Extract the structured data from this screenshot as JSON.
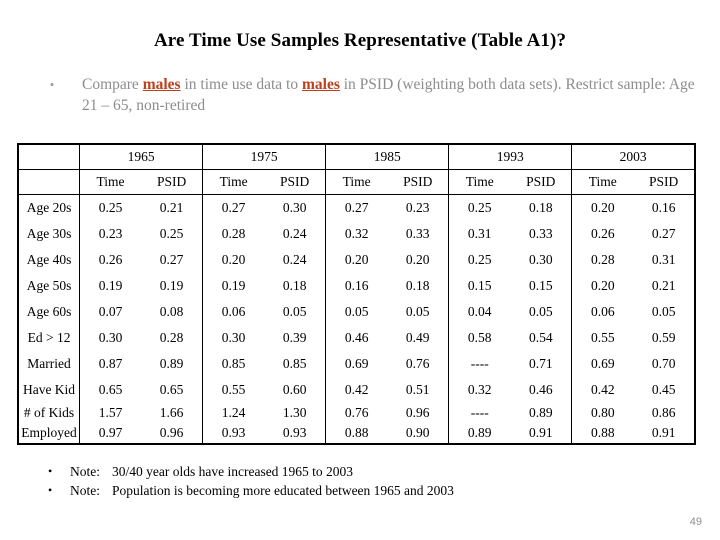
{
  "slide": {
    "title": "Are Time Use Samples Representative (Table A1)?",
    "page_number": "49",
    "accent_red": "#C0401C",
    "body_gray": "#8d8d8d"
  },
  "intro": {
    "bullet_mark": "•",
    "text_part_1": "Compare ",
    "highlight_1": "males",
    "text_part_2": " in time use data to ",
    "highlight_2": "males",
    "text_part_3": " in PSID (weighting both data sets).  Restrict sample:  Age 21 – 65, non-retired"
  },
  "table": {
    "corner_label": "",
    "year_groups": [
      "1965",
      "1975",
      "1985",
      "1993",
      "2003"
    ],
    "sub_headers": [
      "Time",
      "PSID"
    ],
    "rows": [
      {
        "label": "Age 20s",
        "label_red": false,
        "cells": [
          {
            "v": "0.25",
            "red": false
          },
          {
            "v": "0.21",
            "red": false
          },
          {
            "v": "0.27",
            "red": false
          },
          {
            "v": "0.30",
            "red": false
          },
          {
            "v": "0.27",
            "red": false
          },
          {
            "v": "0.23",
            "red": false
          },
          {
            "v": "0.25",
            "red": true
          },
          {
            "v": "0.18",
            "red": true
          },
          {
            "v": "0.20",
            "red": false
          },
          {
            "v": "0.16",
            "red": false
          }
        ]
      },
      {
        "label": "Age 30s",
        "label_red": false,
        "cells": [
          {
            "v": "0.23",
            "red": false
          },
          {
            "v": "0.25",
            "red": false
          },
          {
            "v": "0.28",
            "red": true
          },
          {
            "v": "0.24",
            "red": true
          },
          {
            "v": "0.32",
            "red": false
          },
          {
            "v": "0.33",
            "red": false
          },
          {
            "v": "0.31",
            "red": false
          },
          {
            "v": "0.33",
            "red": false
          },
          {
            "v": "0.26",
            "red": false
          },
          {
            "v": "0.27",
            "red": false
          }
        ]
      },
      {
        "label": "Age 40s",
        "label_red": false,
        "cells": [
          {
            "v": "0.26",
            "red": false
          },
          {
            "v": "0.27",
            "red": false
          },
          {
            "v": "0.20",
            "red": true
          },
          {
            "v": "0.24",
            "red": true
          },
          {
            "v": "0.20",
            "red": false
          },
          {
            "v": "0.20",
            "red": false
          },
          {
            "v": "0.25",
            "red": true
          },
          {
            "v": "0.30",
            "red": true
          },
          {
            "v": "0.28",
            "red": false
          },
          {
            "v": "0.31",
            "red": false
          }
        ]
      },
      {
        "label": "Age 50s",
        "label_red": false,
        "cells": [
          {
            "v": "0.19",
            "red": false
          },
          {
            "v": "0.19",
            "red": false
          },
          {
            "v": "0.19",
            "red": false
          },
          {
            "v": "0.18",
            "red": false
          },
          {
            "v": "0.16",
            "red": false
          },
          {
            "v": "0.18",
            "red": false
          },
          {
            "v": "0.15",
            "red": false
          },
          {
            "v": "0.15",
            "red": false
          },
          {
            "v": "0.20",
            "red": false
          },
          {
            "v": "0.21",
            "red": false
          }
        ]
      },
      {
        "label": "Age 60s",
        "label_red": false,
        "cells": [
          {
            "v": "0.07",
            "red": false
          },
          {
            "v": "0.08",
            "red": false
          },
          {
            "v": "0.06",
            "red": false
          },
          {
            "v": "0.05",
            "red": false
          },
          {
            "v": "0.05",
            "red": false
          },
          {
            "v": "0.05",
            "red": false
          },
          {
            "v": "0.04",
            "red": false
          },
          {
            "v": "0.05",
            "red": false
          },
          {
            "v": "0.06",
            "red": false
          },
          {
            "v": "0.05",
            "red": false
          }
        ]
      },
      {
        "label": "Ed > 12",
        "label_red": true,
        "cells": [
          {
            "v": "0.30",
            "red": true
          },
          {
            "v": "0.28",
            "red": true
          },
          {
            "v": "0.30",
            "red": true
          },
          {
            "v": "0.39",
            "red": true
          },
          {
            "v": "0.46",
            "red": true
          },
          {
            "v": "0.49",
            "red": true
          },
          {
            "v": "0.58",
            "red": true
          },
          {
            "v": "0.54",
            "red": true
          },
          {
            "v": "0.55",
            "red": true
          },
          {
            "v": "0.59",
            "red": true
          }
        ]
      },
      {
        "label": "Married",
        "label_red": false,
        "cells": [
          {
            "v": "0.87",
            "red": false
          },
          {
            "v": "0.89",
            "red": false
          },
          {
            "v": "0.85",
            "red": false
          },
          {
            "v": "0.85",
            "red": false
          },
          {
            "v": "0.69",
            "red": false
          },
          {
            "v": "0.76",
            "red": false
          },
          {
            "v": "----",
            "red": false
          },
          {
            "v": "0.71",
            "red": false
          },
          {
            "v": "0.69",
            "red": false
          },
          {
            "v": "0.70",
            "red": false
          }
        ]
      },
      {
        "label": "Have Kid",
        "label_red": false,
        "cells": [
          {
            "v": "0.65",
            "red": false
          },
          {
            "v": "0.65",
            "red": false
          },
          {
            "v": "0.55",
            "red": false
          },
          {
            "v": "0.60",
            "red": false
          },
          {
            "v": "0.42",
            "red": true
          },
          {
            "v": "0.51",
            "red": true
          },
          {
            "v": "0.32",
            "red": true
          },
          {
            "v": "0.46",
            "red": true
          },
          {
            "v": "0.42",
            "red": false
          },
          {
            "v": "0.45",
            "red": false
          }
        ]
      },
      {
        "label": "# of Kids",
        "label_red": false,
        "tight": true,
        "cells": [
          {
            "v": "1.57",
            "red": false
          },
          {
            "v": "1.66",
            "red": false
          },
          {
            "v": "1.24",
            "red": false
          },
          {
            "v": "1.30",
            "red": false
          },
          {
            "v": "0.76",
            "red": false
          },
          {
            "v": "0.96",
            "red": false
          },
          {
            "v": "----",
            "red": false
          },
          {
            "v": "0.89",
            "red": false
          },
          {
            "v": "0.80",
            "red": false
          },
          {
            "v": "0.86",
            "red": false
          }
        ]
      },
      {
        "label": "Employed",
        "label_red": false,
        "tight": true,
        "cells": [
          {
            "v": "0.97",
            "red": false
          },
          {
            "v": "0.96",
            "red": false
          },
          {
            "v": "0.93",
            "red": false
          },
          {
            "v": "0.93",
            "red": false
          },
          {
            "v": "0.88",
            "red": false
          },
          {
            "v": "0.90",
            "red": false
          },
          {
            "v": "0.89",
            "red": false
          },
          {
            "v": "0.91",
            "red": false
          },
          {
            "v": "0.88",
            "red": false
          },
          {
            "v": "0.91",
            "red": false
          }
        ]
      }
    ]
  },
  "notes": [
    {
      "bullet_mark": "•",
      "label": "Note:",
      "text": "30/40 year olds have increased 1965 to 2003"
    },
    {
      "bullet_mark": "•",
      "label": "Note:",
      "text": "Population is becoming more educated between 1965 and 2003"
    }
  ]
}
